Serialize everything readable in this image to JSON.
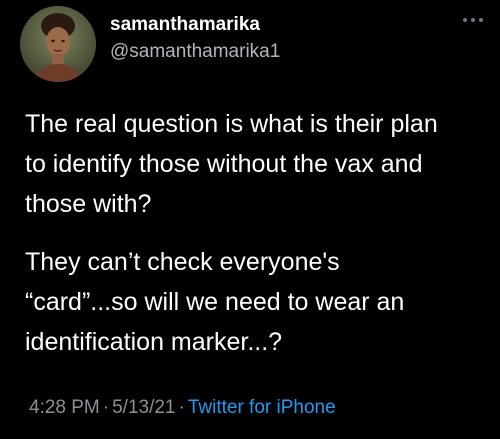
{
  "author": {
    "display_name": "samanthamarika",
    "handle": "@samanthamarika1"
  },
  "tweet": {
    "paragraphs": [
      {
        "lines": [
          "The real question is what is their plan",
          "to identify those without the vax and",
          "those with?"
        ]
      },
      {
        "lines": [
          "They can’t check everyone's",
          "“card”...so will we need to wear an",
          "identification marker...?"
        ]
      }
    ]
  },
  "meta": {
    "time": "4:28 PM",
    "separator": "·",
    "date": "5/13/21",
    "source": "Twitter for iPhone"
  },
  "icons": {
    "more": "more-horizontal-icon"
  },
  "colors": {
    "background": "#000000",
    "text": "#ffffff",
    "secondary_text": "#8b9096",
    "link": "#1d9bf0"
  }
}
